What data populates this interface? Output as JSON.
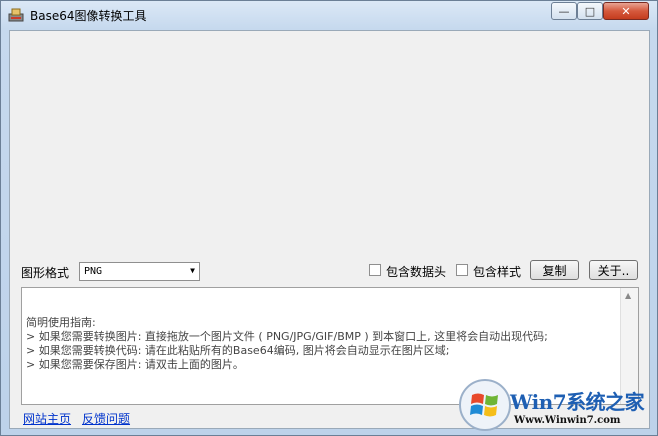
{
  "window": {
    "title": "Base64图像转换工具",
    "buttons": {
      "minimize": "—",
      "maximize": "□",
      "close": "✕"
    }
  },
  "controls": {
    "format_label": "图形格式",
    "format_value": "PNG",
    "include_header_label": "包含数据头",
    "include_style_label": "包含样式",
    "include_header_checked": false,
    "include_style_checked": false,
    "copy_button": "复制",
    "about_button": "关于.."
  },
  "guide": {
    "lines": [
      "简明使用指南:",
      "> 如果您需要转换图片: 直接拖放一个图片文件 ( PNG/JPG/GIF/BMP ) 到本窗口上, 这里将会自动出现代码;",
      "> 如果您需要转换代码: 请在此粘贴所有的Base64编码, 图片将会自动显示在图片区域;",
      "> 如果您需要保存图片: 请双击上面的图片。"
    ]
  },
  "footer": {
    "home_link": "网站主页",
    "feedback_link": "反馈问题"
  },
  "watermark": {
    "brand": "Win7系统之家",
    "url": "Www.Winwin7.com"
  },
  "icons": {
    "app": "app-icon",
    "dropdown": "chevron-down-icon",
    "scroll_up": "scroll-up-icon",
    "logo": "windows-logo-icon"
  }
}
